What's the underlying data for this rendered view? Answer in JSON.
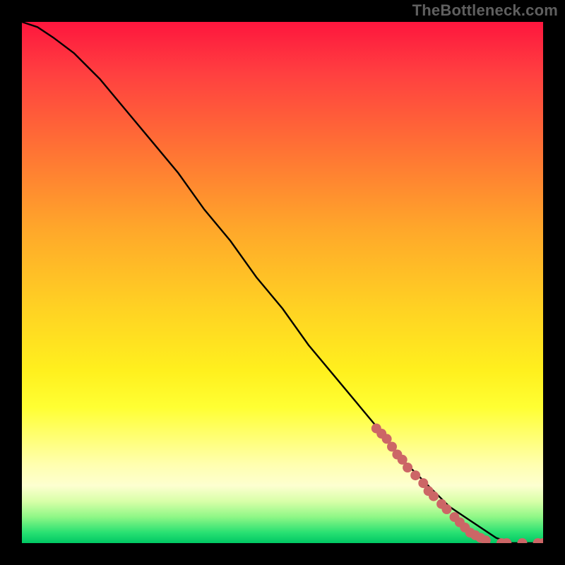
{
  "watermark": "TheBottleneck.com",
  "colors": {
    "frame": "#000000",
    "curve": "#000000",
    "marker": "#cc6666",
    "gradient_top": "#fe163e",
    "gradient_bottom": "#00c864"
  },
  "chart_data": {
    "type": "line",
    "title": "",
    "xlabel": "",
    "ylabel": "",
    "xlim": [
      0,
      100
    ],
    "ylim": [
      0,
      100
    ],
    "grid": false,
    "legend": false,
    "series": [
      {
        "name": "curve",
        "x": [
          0,
          3,
          6,
          10,
          15,
          20,
          25,
          30,
          35,
          40,
          45,
          50,
          55,
          60,
          65,
          70,
          73,
          76,
          79,
          82,
          85,
          88,
          91,
          94,
          97,
          100
        ],
        "y": [
          100,
          99,
          97,
          94,
          89,
          83,
          77,
          71,
          64,
          58,
          51,
          45,
          38,
          32,
          26,
          20,
          16,
          13,
          10,
          7,
          5,
          3,
          1,
          0,
          0,
          0
        ]
      }
    ],
    "markers": [
      {
        "x": 68,
        "y": 22
      },
      {
        "x": 69,
        "y": 21
      },
      {
        "x": 70,
        "y": 20
      },
      {
        "x": 71,
        "y": 18.5
      },
      {
        "x": 72,
        "y": 17
      },
      {
        "x": 73,
        "y": 16
      },
      {
        "x": 74,
        "y": 14.5
      },
      {
        "x": 75.5,
        "y": 13
      },
      {
        "x": 77,
        "y": 11.5
      },
      {
        "x": 78,
        "y": 10
      },
      {
        "x": 79,
        "y": 9
      },
      {
        "x": 80.5,
        "y": 7.5
      },
      {
        "x": 81.5,
        "y": 6.5
      },
      {
        "x": 83,
        "y": 5
      },
      {
        "x": 84,
        "y": 4
      },
      {
        "x": 85,
        "y": 3
      },
      {
        "x": 86,
        "y": 2
      },
      {
        "x": 87,
        "y": 1.5
      },
      {
        "x": 88,
        "y": 1
      },
      {
        "x": 89,
        "y": 0.5
      },
      {
        "x": 92,
        "y": 0
      },
      {
        "x": 93,
        "y": 0
      },
      {
        "x": 96,
        "y": 0
      },
      {
        "x": 99,
        "y": 0
      },
      {
        "x": 100,
        "y": 0
      }
    ]
  }
}
